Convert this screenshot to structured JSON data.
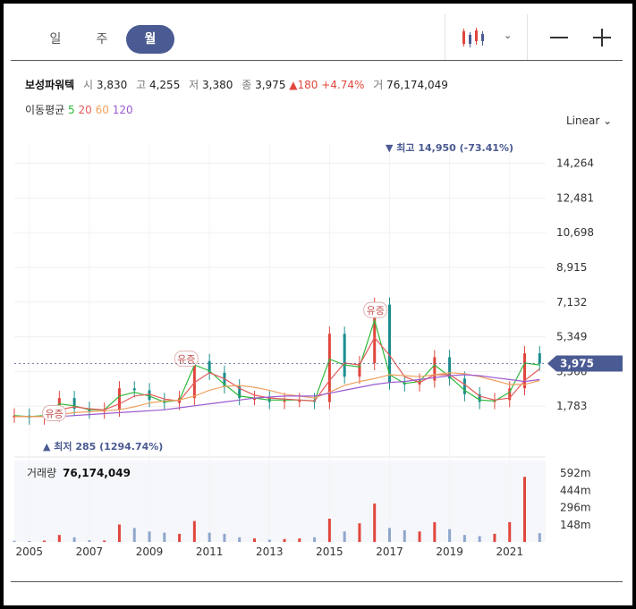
{
  "tabs": {
    "day": "일",
    "week": "주",
    "month": "월"
  },
  "stock": {
    "name": "보성파워텍",
    "open_label": "시",
    "open": "3,830",
    "high_label": "고",
    "high": "4,255",
    "low_label": "저",
    "low": "3,380",
    "close_label": "종",
    "close": "3,975",
    "change": "▲180",
    "change_pct": "+4.74%",
    "vol_label": "거",
    "volume": "76,174,049"
  },
  "ma": {
    "label": "이동평균",
    "p5": "5",
    "p20": "20",
    "p60": "60",
    "p120": "120",
    "c5": "#2eb83a",
    "c20": "#e65a5a",
    "c60": "#f0a260",
    "c120": "#9b59d0"
  },
  "scale_label": "Linear",
  "colors": {
    "up": "#e0463c",
    "down": "#1c8d8d",
    "accent": "#4a5a92"
  },
  "chart_data": {
    "type": "line",
    "title": "",
    "price_axis_ticks": [
      1783,
      3566,
      5349,
      7132,
      8915,
      10698,
      12481,
      14264
    ],
    "price_axis_tick_labels": [
      "1,783",
      "3,566",
      "5,349",
      "7,132",
      "8,915",
      "10,698",
      "12,481",
      "14,264"
    ],
    "x_tick_labels": [
      "2005",
      "2007",
      "2009",
      "2011",
      "2013",
      "2015",
      "2017",
      "2019",
      "2021"
    ],
    "current_price": 3975,
    "current_price_label": "3,975",
    "max_annotation": "최고 14,950 (-73.41%)",
    "min_annotation": "최저 285 (1294.74%)",
    "event_label": "유증",
    "event_points": [
      {
        "x": 2005.8,
        "y": 1400
      },
      {
        "x": 2010.2,
        "y": 4200
      },
      {
        "x": 2016.5,
        "y": 6700
      }
    ],
    "x": [
      2004.5,
      2005,
      2005.5,
      2006,
      2006.5,
      2007,
      2007.5,
      2008,
      2008.5,
      2009,
      2009.5,
      2010,
      2010.5,
      2011,
      2011.5,
      2012,
      2012.5,
      2013,
      2013.5,
      2014,
      2014.5,
      2015,
      2015.5,
      2016,
      2016.5,
      2017,
      2017.5,
      2018,
      2018.5,
      2019,
      2019.5,
      2020,
      2020.5,
      2021,
      2021.5,
      2022
    ],
    "series": [
      {
        "name": "종가",
        "values": [
          1300,
          1200,
          1350,
          2200,
          1650,
          1500,
          1600,
          2700,
          2600,
          2100,
          1950,
          2200,
          4100,
          3500,
          2800,
          2200,
          2200,
          2000,
          2100,
          2100,
          2000,
          5500,
          3300,
          4000,
          7000,
          3000,
          2900,
          3100,
          4300,
          3200,
          2400,
          2000,
          2100,
          2700,
          4500,
          3975
        ]
      },
      {
        "name": "이동평균 5",
        "values": [
          1300,
          1250,
          1300,
          1900,
          1800,
          1600,
          1600,
          2300,
          2500,
          2300,
          2000,
          2100,
          3900,
          3600,
          2900,
          2300,
          2200,
          2100,
          2100,
          2100,
          2050,
          4200,
          3900,
          3800,
          6200,
          3400,
          2950,
          3050,
          3900,
          3300,
          2600,
          2100,
          2050,
          2500,
          4000,
          3900
        ]
      },
      {
        "name": "이동평균 20",
        "values": [
          1250,
          1250,
          1250,
          1600,
          1750,
          1650,
          1600,
          1900,
          2300,
          2400,
          2150,
          2050,
          3000,
          3500,
          3200,
          2700,
          2350,
          2200,
          2150,
          2100,
          2050,
          3100,
          4000,
          3900,
          5300,
          4400,
          3300,
          3000,
          3400,
          3400,
          2900,
          2300,
          2100,
          2200,
          3100,
          3700
        ]
      },
      {
        "name": "이동평균 60",
        "values": [
          1250,
          1250,
          1250,
          1350,
          1450,
          1500,
          1550,
          1600,
          1750,
          1950,
          2050,
          2100,
          2300,
          2600,
          2800,
          2850,
          2750,
          2600,
          2400,
          2300,
          2200,
          2500,
          2850,
          3050,
          3200,
          3400,
          3350,
          3300,
          3400,
          3500,
          3450,
          3300,
          3100,
          2900,
          2900,
          3100
        ]
      },
      {
        "name": "이동평균 120",
        "values": [
          null,
          null,
          null,
          1250,
          1300,
          1350,
          1400,
          1450,
          1500,
          1550,
          1600,
          1700,
          1800,
          1900,
          2000,
          2100,
          2200,
          2250,
          2300,
          2300,
          2300,
          2450,
          2600,
          2750,
          2900,
          3000,
          3050,
          3150,
          3250,
          3350,
          3400,
          3350,
          3250,
          3150,
          3050,
          3150
        ]
      }
    ],
    "volume": {
      "label": "거래량",
      "value": "76,174,049",
      "tick_labels": [
        "148m",
        "296m",
        "444m",
        "592m"
      ],
      "ticks": [
        148,
        296,
        444,
        592
      ],
      "values": [
        10,
        8,
        12,
        60,
        40,
        15,
        12,
        150,
        120,
        90,
        80,
        70,
        180,
        80,
        70,
        40,
        30,
        20,
        25,
        30,
        40,
        200,
        90,
        160,
        330,
        120,
        100,
        90,
        170,
        110,
        60,
        50,
        70,
        170,
        560,
        76
      ]
    }
  }
}
